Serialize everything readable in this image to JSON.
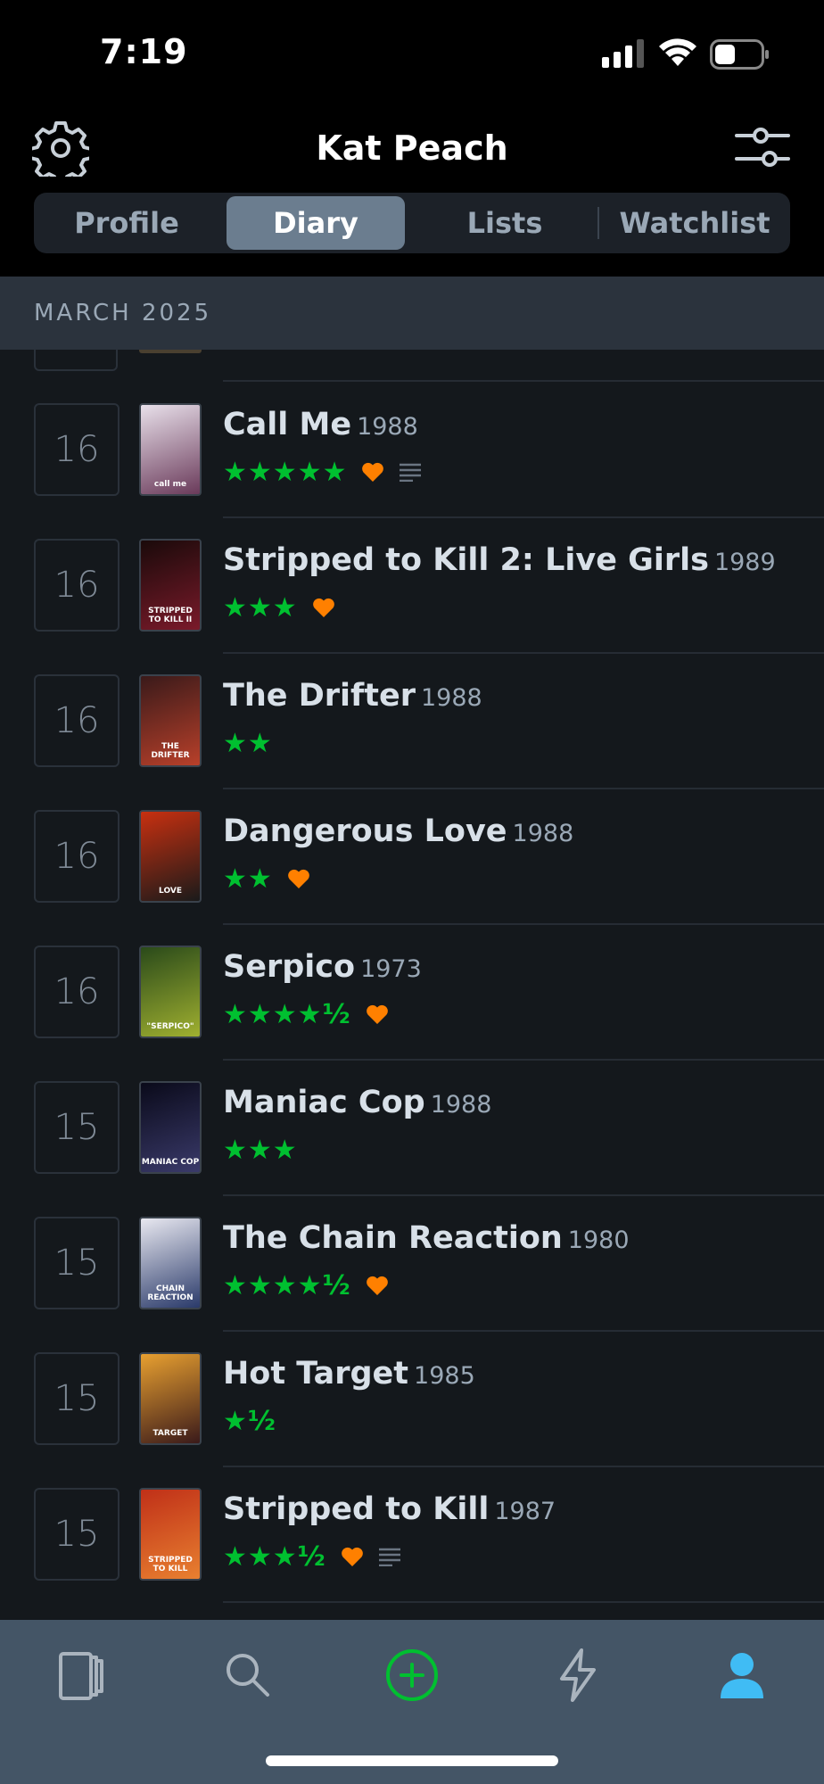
{
  "status_bar": {
    "time": "7:19"
  },
  "header": {
    "title": "Kat Peach"
  },
  "tabs": [
    {
      "label": "Profile",
      "active": false
    },
    {
      "label": "Diary",
      "active": true
    },
    {
      "label": "Lists",
      "active": false
    },
    {
      "label": "Watchlist",
      "active": false
    }
  ],
  "month": "MARCH 2025",
  "entries": [
    {
      "day": "16",
      "title": "Call Me",
      "year": "1988",
      "stars": "★★★★★",
      "liked": true,
      "review": true,
      "poster_text": "call me"
    },
    {
      "day": "16",
      "title": "Stripped to Kill 2: Live Girls",
      "year": "1989",
      "stars": "★★★",
      "liked": true,
      "review": false,
      "poster_text": "STRIPPED TO KILL II"
    },
    {
      "day": "16",
      "title": "The Drifter",
      "year": "1988",
      "stars": "★★",
      "liked": false,
      "review": false,
      "poster_text": "THE DRIFTER"
    },
    {
      "day": "16",
      "title": "Dangerous Love",
      "year": "1988",
      "stars": "★★",
      "liked": true,
      "review": false,
      "poster_text": "LOVE"
    },
    {
      "day": "16",
      "title": "Serpico",
      "year": "1973",
      "stars": "★★★★½",
      "liked": true,
      "review": false,
      "poster_text": "\"SERPICO\""
    },
    {
      "day": "15",
      "title": "Maniac Cop",
      "year": "1988",
      "stars": "★★★",
      "liked": false,
      "review": false,
      "poster_text": "MANIAC COP"
    },
    {
      "day": "15",
      "title": "The Chain Reaction",
      "year": "1980",
      "stars": "★★★★½",
      "liked": true,
      "review": false,
      "poster_text": "CHAIN REACTION"
    },
    {
      "day": "15",
      "title": "Hot Target",
      "year": "1985",
      "stars": "★½",
      "liked": false,
      "review": false,
      "poster_text": "TARGET"
    },
    {
      "day": "15",
      "title": "Stripped to Kill",
      "year": "1987",
      "stars": "★★★½",
      "liked": true,
      "review": true,
      "poster_text": "STRIPPED TO KILL"
    }
  ],
  "colors": {
    "star": "#00c030",
    "heart": "#ff8000",
    "accent_profile": "#40bcf4",
    "add": "#00c030"
  },
  "tab_bar": [
    {
      "name": "films-icon",
      "active": false
    },
    {
      "name": "search-icon",
      "active": false
    },
    {
      "name": "add-icon",
      "active": false
    },
    {
      "name": "activity-icon",
      "active": false
    },
    {
      "name": "profile-icon",
      "active": true
    }
  ]
}
